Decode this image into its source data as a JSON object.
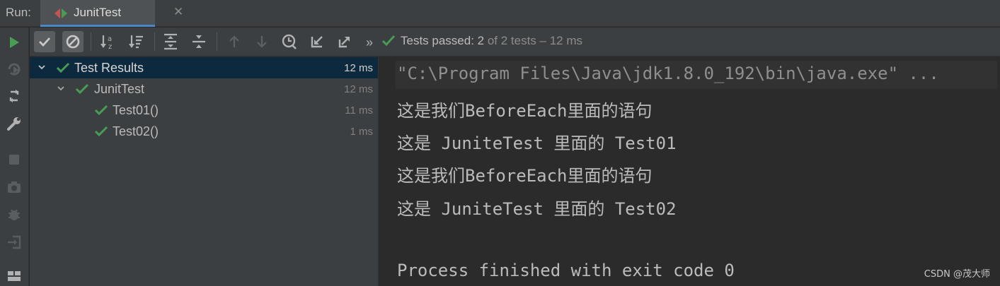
{
  "tabbar": {
    "run_label": "Run:",
    "tab_title": "JunitTest",
    "tab_close": "✕"
  },
  "vertical_toolbar": {
    "icons": [
      "rerun-icon",
      "rerun-failed-icon",
      "toggle-auto-test-icon",
      "settings-wrench-icon",
      "stop-icon",
      "screenshot-icon",
      "debug-icon",
      "exit-icon",
      "layout-icon"
    ]
  },
  "toolbar": {
    "icons": [
      "show-passed-icon",
      "show-ignored-icon",
      "sort-alphabetically-icon",
      "sort-by-duration-icon",
      "expand-all-icon",
      "collapse-all-icon",
      "previous-failed-icon",
      "next-failed-icon",
      "history-icon",
      "import-tests-icon",
      "export-tests-icon",
      "more-icon"
    ],
    "more_label": "»",
    "status_main": "Tests passed: 2",
    "status_sub": " of 2 tests – 12 ms"
  },
  "tree": {
    "rows": [
      {
        "label": "Test Results",
        "time": "12 ms",
        "level": 0,
        "expanded": true,
        "selected": true
      },
      {
        "label": "JunitTest",
        "time": "12 ms",
        "level": 1,
        "expanded": true,
        "selected": false
      },
      {
        "label": "Test01()",
        "time": "11 ms",
        "level": 2,
        "selected": false
      },
      {
        "label": "Test02()",
        "time": "1 ms",
        "level": 2,
        "selected": false
      }
    ]
  },
  "console": {
    "lines": [
      "\"C:\\Program Files\\Java\\jdk1.8.0_192\\bin\\java.exe\" ...",
      "这是我们BeforeEach里面的语句",
      "这是 JuniteTest 里面的 Test01",
      "这是我们BeforeEach里面的语句",
      "这是 JuniteTest 里面的 Test02",
      "",
      "Process finished with exit code 0"
    ]
  },
  "watermark": "CSDN @茂大师",
  "colors": {
    "pass_green": "#499c54",
    "selection": "#0d293e",
    "panel_bg": "#3c3f41",
    "console_bg": "#2b2b2b"
  }
}
